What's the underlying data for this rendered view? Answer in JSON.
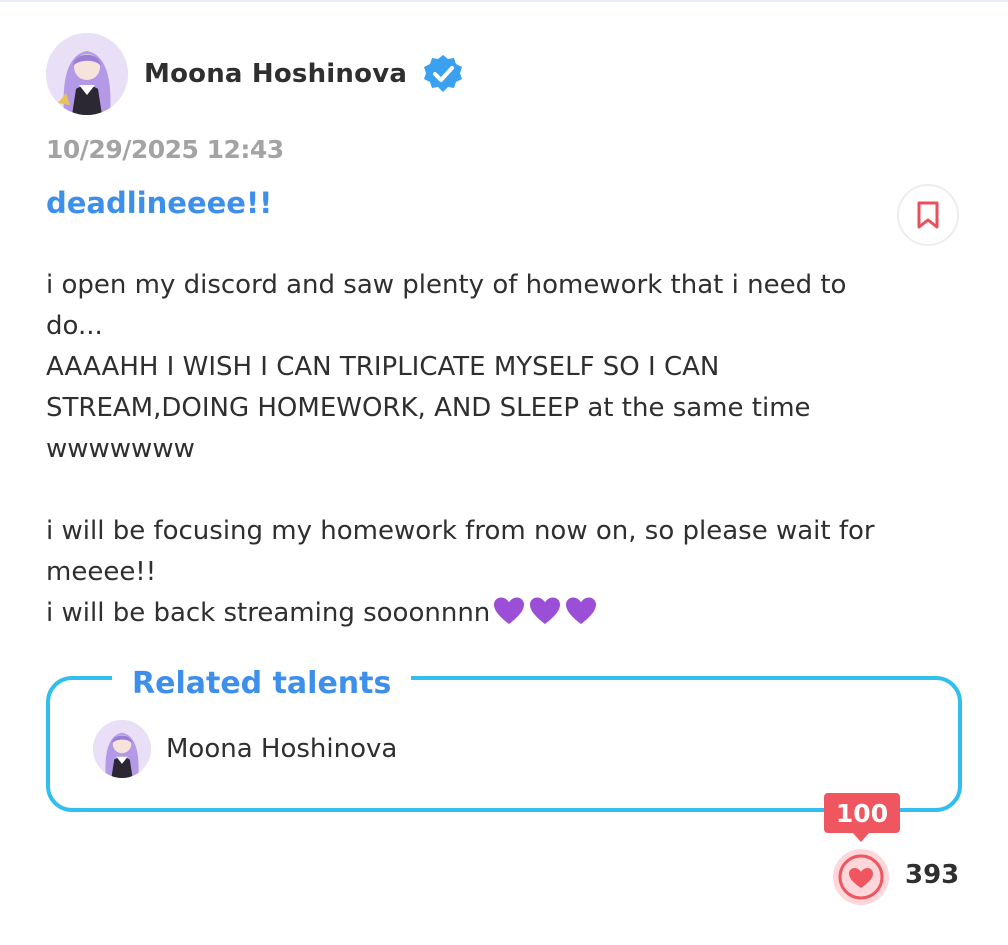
{
  "post": {
    "author": "Moona Hoshinova",
    "timestamp": "10/29/2025 12:43",
    "title": "deadlineeee!!",
    "body_lines": [
      "i open my discord and saw plenty of homework that i need to",
      "do...",
      "AAAAHH I WISH I CAN TRIPLICATE MYSELF SO I CAN",
      "STREAM,DOING HOMEWORK, AND SLEEP at the same time",
      "wwwwwww",
      "",
      "i will be focusing my homework from now on, so please wait for",
      "meeee!!",
      "i will be back streaming sooonnnn"
    ],
    "trailing_emoji": [
      "purple-heart-emoji",
      "purple-heart-emoji",
      "purple-heart-emoji"
    ]
  },
  "related": {
    "heading": "Related talents",
    "talents": [
      {
        "name": "Moona Hoshinova"
      }
    ]
  },
  "reactions": {
    "badge": "100",
    "likes": "393"
  },
  "colors": {
    "accent_blue": "#3d8fea",
    "box_border": "#33bfee",
    "like_red": "#f0565f",
    "verified_blue": "#3aa0f0",
    "bookmark_red": "#e8505b",
    "purple_heart": "#9b4fd6"
  },
  "icons": {
    "verified": "verified-badge-icon",
    "bookmark": "bookmark-icon",
    "like": "heart-icon"
  }
}
